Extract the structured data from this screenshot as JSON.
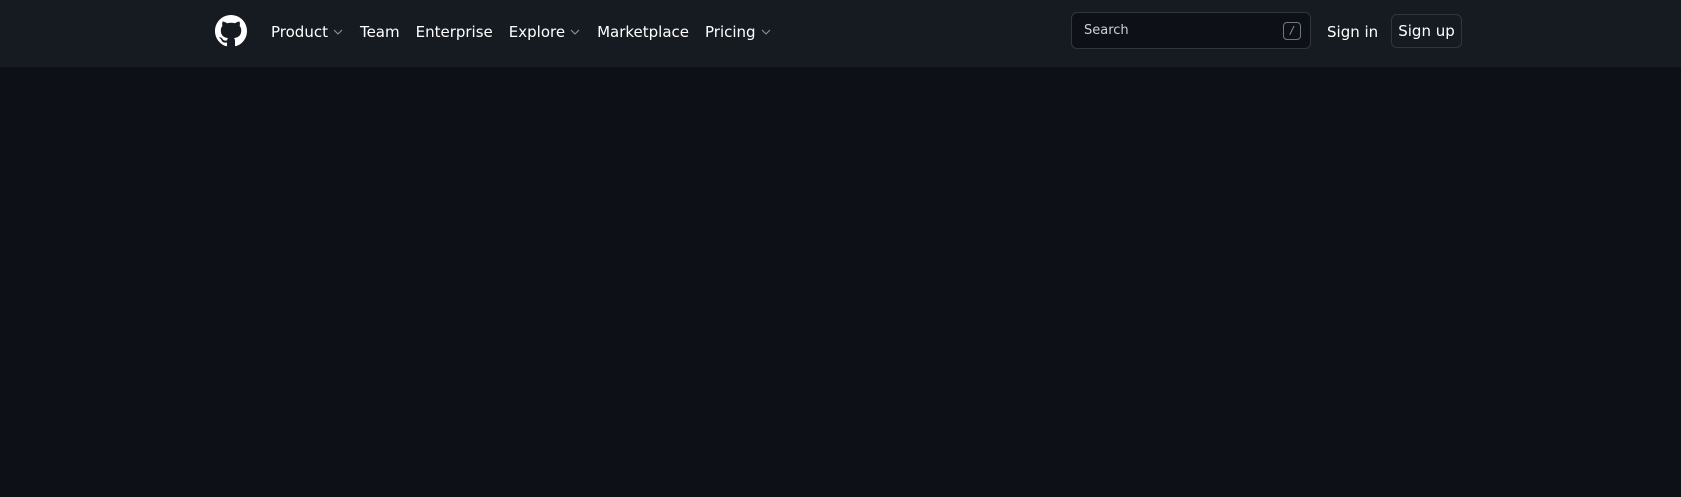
{
  "header": {
    "logo_icon": "github-mark-icon",
    "nav": {
      "product_label": "Product",
      "team_label": "Team",
      "enterprise_label": "Enterprise",
      "explore_label": "Explore",
      "marketplace_label": "Marketplace",
      "pricing_label": "Pricing"
    },
    "search": {
      "placeholder": "Search",
      "shortcut_key": "/"
    },
    "signin_label": "Sign in",
    "signup_label": "Sign up"
  },
  "colors": {
    "header_bg": "#161b22",
    "page_bg": "#0d1117",
    "text": "#ffffff",
    "border": "#30363d"
  }
}
